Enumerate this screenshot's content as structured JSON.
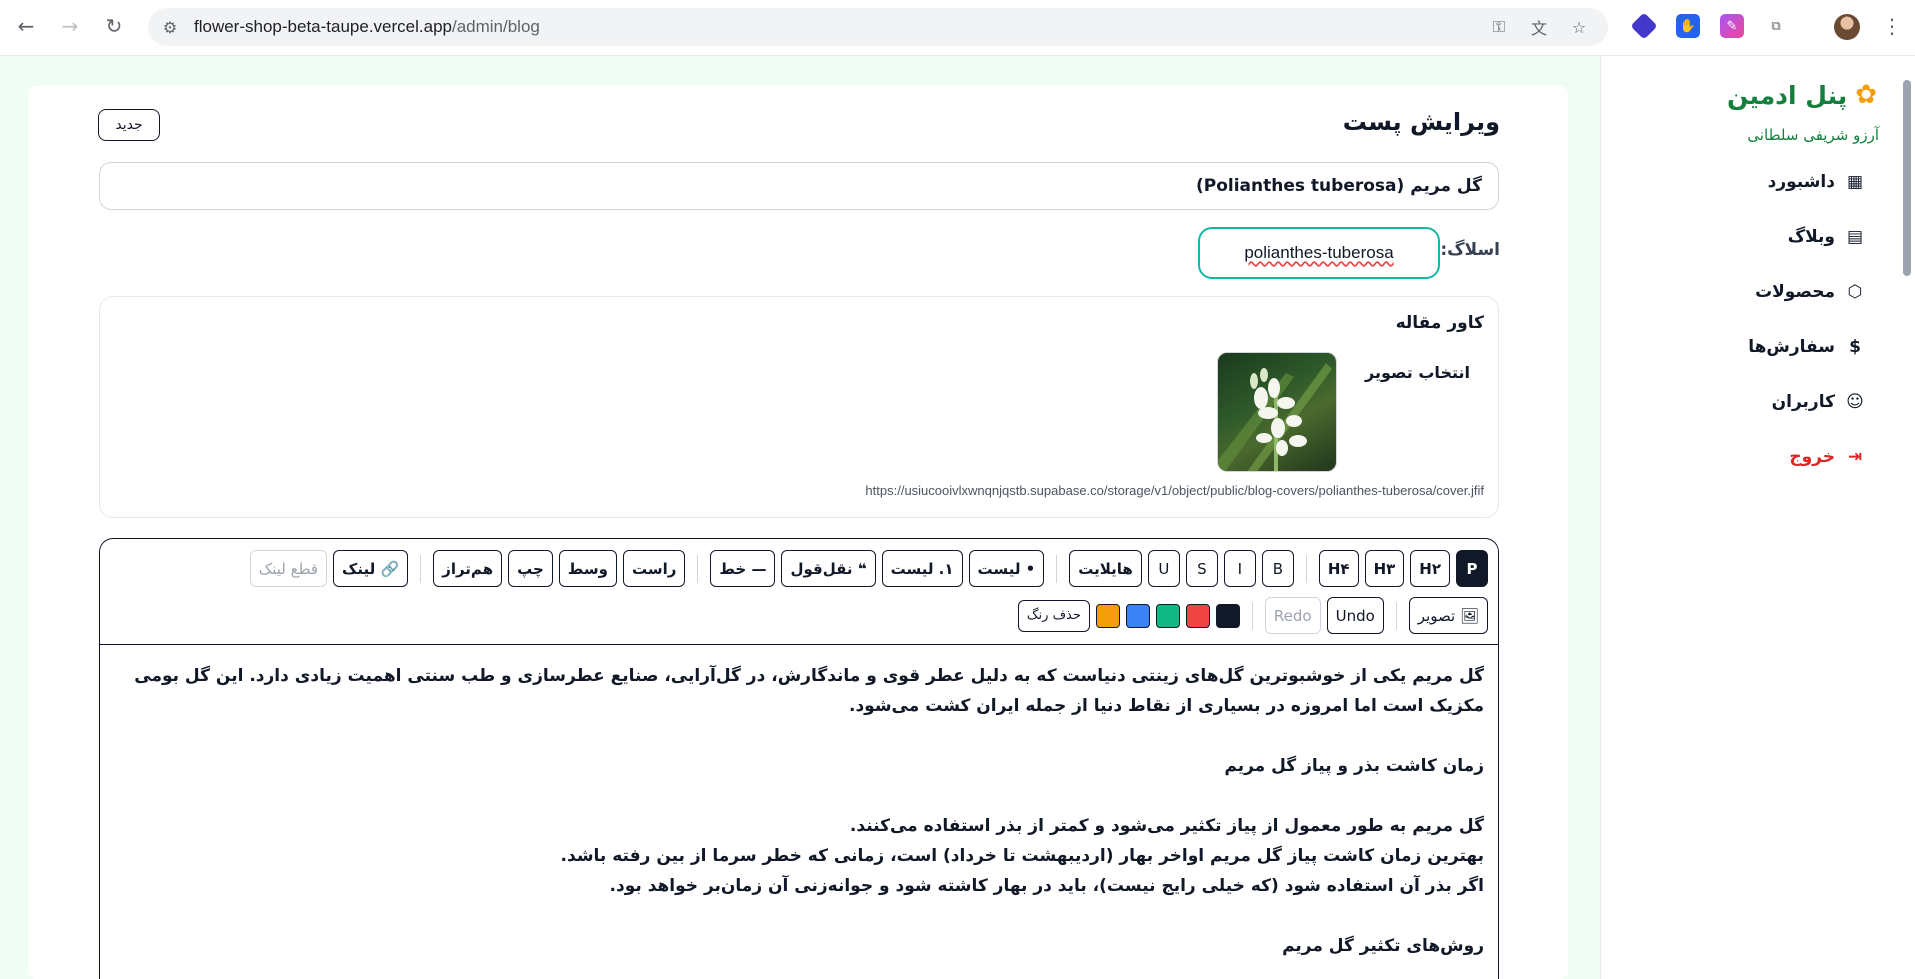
{
  "browser": {
    "url_host": "flower-shop-beta-taupe.vercel.app",
    "url_path": "/admin/blog"
  },
  "sidebar": {
    "brand": "پنل ادمین",
    "user": "آرزو شریفی سلطانی",
    "items": [
      {
        "label": "داشبورد",
        "icon": "dashboard-icon"
      },
      {
        "label": "وبلاگ",
        "icon": "blog-icon"
      },
      {
        "label": "محصولات",
        "icon": "box-icon"
      },
      {
        "label": "سفارش‌ها",
        "icon": "receipt-icon"
      },
      {
        "label": "کاربران",
        "icon": "user-icon"
      },
      {
        "label": "خروج",
        "icon": "logout-icon",
        "color": "#dc2626"
      }
    ]
  },
  "editor": {
    "page_title": "ویرایش پست",
    "new_button": "جدید",
    "post_title": "گل مریم (Polianthes tuberosa)",
    "slug_label": "اسلاگ:",
    "slug_value": "polianthes-tuberosa",
    "cover_title": "کاور مقاله",
    "choose_image": "انتخاب تصویر",
    "cover_url": "https://usiucooivlxwnqnjqstb.supabase.co/storage/v1/object/public/blog-covers/polianthes-tuberosa/cover.jfif",
    "toolbar_row1": [
      "P",
      "H۲",
      "H۳",
      "H۴",
      "B",
      "I",
      "S",
      "U",
      "هایلایت",
      "• لیست",
      "۱. لیست",
      "❝ نقل‌قول",
      "— خط",
      "راست",
      "وسط",
      "چپ",
      "هم‌تراز",
      "🔗 لینک",
      "قطع لینک"
    ],
    "toolbar_row2": {
      "image": "🖼 تصویر",
      "undo": "Undo",
      "redo": "Redo",
      "remove_color": "حذف رنگ",
      "colors": [
        "#111827",
        "#ef4444",
        "#10b981",
        "#3b82f6",
        "#f59e0b"
      ]
    },
    "content": {
      "para1": "گل مریم یکی از خوشبوترین گل‌های زینتی دنیاست که به دلیل عطر قوی و ماندگارش، در گل‌آرایی، صنایع عطرسازی و طب سنتی اهمیت زیادی دارد. این گل بومی مکزیک است اما امروزه در بسیاری از نقاط دنیا از جمله ایران کشت می‌شود.",
      "heading1": "زمان کاشت بذر و پیاز گل مریم",
      "line1": "گل مریم به طور معمول از پیاز تکثیر می‌شود و کمتر از بذر استفاده می‌کنند.",
      "line2": "بهترین زمان کاشت پیاز گل مریم اواخر بهار (اردیبهشت تا خرداد) است، زمانی که خطر سرما از بین رفته باشد.",
      "line3": "اگر بذر آن استفاده شود (که خیلی رایج نیست)، باید در بهار کاشته شود و جوانه‌زنی آن زمان‌بر خواهد بود.",
      "heading2": "روش‌های تکثیر گل مریم"
    }
  }
}
